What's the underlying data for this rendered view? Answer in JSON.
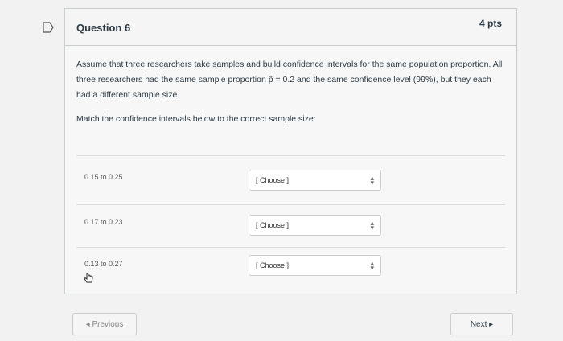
{
  "question": {
    "title": "Question 6",
    "points": "4 pts",
    "text": "Assume that three researchers take samples and build confidence intervals for the same population proportion. All three researchers had the same sample proportion p̂ = 0.2 and the same confidence level (99%), but they each had a different sample size.",
    "instruction": "Match the confidence intervals below to the correct sample size:"
  },
  "matches": [
    {
      "label": "0.15 to 0.25",
      "select_value": "[ Choose ]"
    },
    {
      "label": "0.17 to 0.23",
      "select_value": "[ Choose ]"
    },
    {
      "label": "0.13 to 0.27",
      "select_value": "[ Choose ]"
    }
  ],
  "nav": {
    "previous_label": "◂ Previous",
    "next_label": "Next ▸"
  }
}
